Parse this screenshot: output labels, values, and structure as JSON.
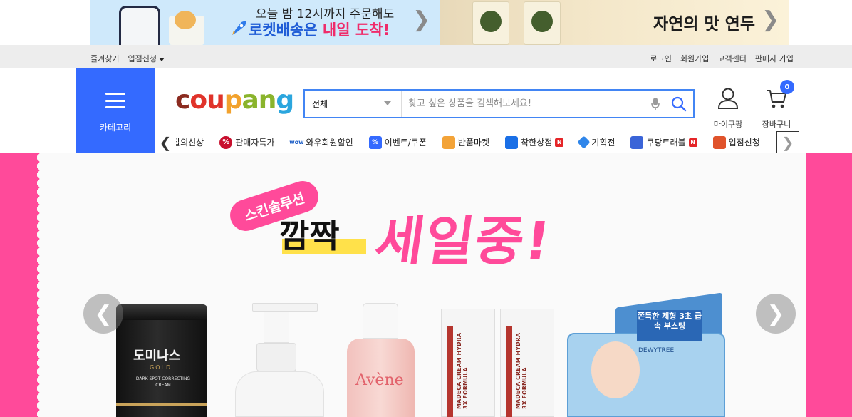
{
  "promo": {
    "left": {
      "line1": "오늘 밤 12시까지 주문해도",
      "line2_blue": "로켓배송은",
      "line2_pink": "내일 도착!",
      "arrow": "❯"
    },
    "right": {
      "title": "자연의 맛 연두",
      "arrow": "❯"
    }
  },
  "utility": {
    "left": [
      "즐겨찾기",
      "입점신청"
    ],
    "right": [
      "로그인",
      "회원가입",
      "고객센터",
      "판매자 가입"
    ]
  },
  "header": {
    "category_label": "카테고리",
    "logo": {
      "p1": "c",
      "p2": "ou",
      "p3": "p",
      "p4": "an",
      "p5": "g"
    },
    "search": {
      "category": "전체",
      "placeholder": "찾고 싶은 상품을 검색해보세요!"
    },
    "mycoupang": "마이쿠팡",
    "cart": {
      "label": "장바구니",
      "count": "0"
    }
  },
  "quicknav": {
    "items": [
      {
        "label": "이달의신상",
        "icon": "calendar-icon",
        "color": "#ffffff"
      },
      {
        "label": "판매자특가",
        "icon": "percent-icon",
        "color": "#c8102e"
      },
      {
        "label": "와우회원할인",
        "icon": "wow-icon",
        "color": "#1e5fc7"
      },
      {
        "label": "이벤트/쿠폰",
        "icon": "coupon-icon",
        "color": "#346aff"
      },
      {
        "label": "반품마켓",
        "icon": "market-icon",
        "color": "#f3a338"
      },
      {
        "label": "착한상점",
        "icon": "store-icon",
        "color": "#1a6fe6",
        "badge": "N"
      },
      {
        "label": "기획전",
        "icon": "tag-icon",
        "color": "#2f86ea"
      },
      {
        "label": "쿠팡트래블",
        "icon": "building-icon",
        "color": "#3a64d8",
        "badge": "N"
      },
      {
        "label": "입점신청",
        "icon": "shop-icon",
        "color": "#e0532b"
      }
    ],
    "prev": "❮",
    "next": "❯"
  },
  "hero": {
    "pill": "스킨솔루션",
    "kkam": "깜짝",
    "sale": "세일중!",
    "prev": "❮",
    "next": "❯",
    "jar": {
      "name": "도미나스",
      "sub": "GOLD",
      "desc": "DARK SPOT CORRECTING CREAM"
    },
    "pink_bottle": "Avène",
    "tube_text": "MADECA CREAM HYDRA 3X FORMULA",
    "pad": {
      "tag": "쫀득한 제형 3초 급속 부스팅",
      "brand": "DEWYTREE"
    },
    "colors": {
      "pink": "#ff4a9a",
      "accent": "#346aff"
    }
  }
}
